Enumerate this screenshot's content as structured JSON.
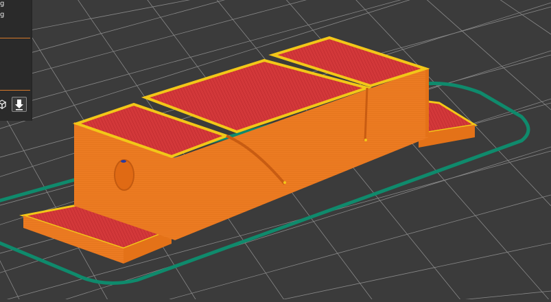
{
  "viewport": {
    "background": "#3b3b3b",
    "grid_color": "#9a9a9a",
    "skirt_color": "#0e8c6e",
    "wall_color": "#ed7d24",
    "infill_color": "#d5383a",
    "perimeter_color": "#f0c81c"
  },
  "panel": {
    "stat_1": "g",
    "stat_2": "g",
    "icons": [
      "cube-view-icon",
      "export-gcode-icon"
    ]
  }
}
